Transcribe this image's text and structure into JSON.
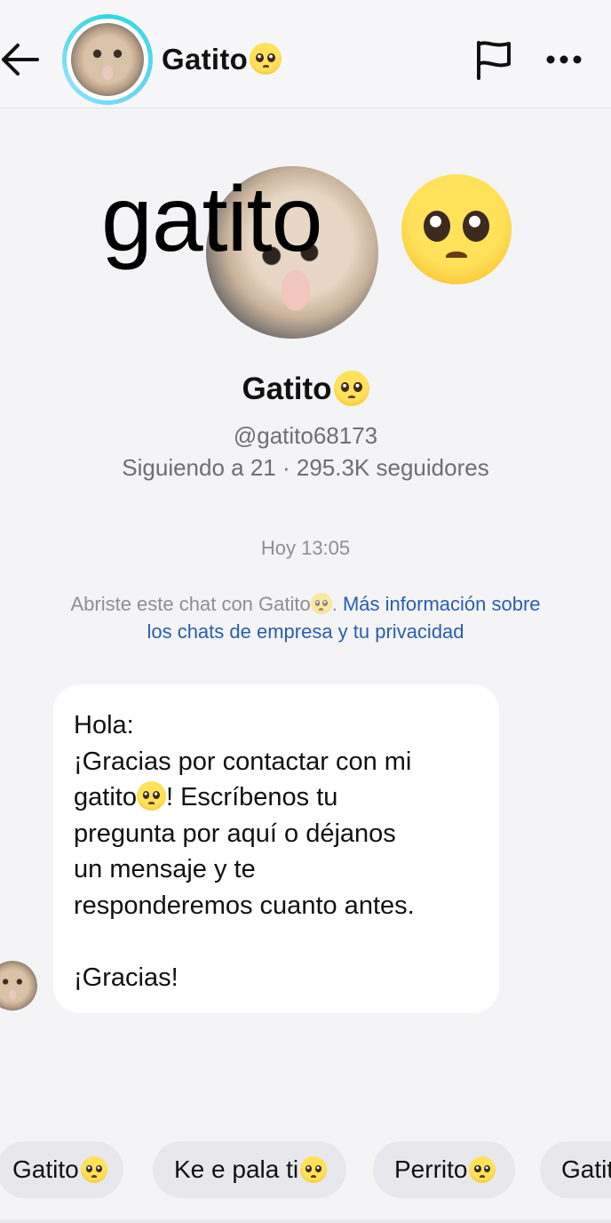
{
  "header": {
    "title": "Gatito",
    "back_icon": "back-arrow-icon",
    "flag_icon": "flag-icon",
    "more_icon": "more-options-icon"
  },
  "profile": {
    "overlay_text": "gatito",
    "name": "Gatito",
    "handle": "@gatito68173",
    "stats": "Siguiendo a 21 · 295.3K seguidores"
  },
  "chat": {
    "timestamp": "Hoy 13:05",
    "notice_prefix": "Abriste este chat con Gatito",
    "notice_suffix": ".",
    "notice_link": "Más información sobre los chats de empresa y tu privacidad",
    "message_part1": "Hola:\n¡Gracias por contactar con mi gatito",
    "message_part2": "! Escríbenos tu\npregunta por aquí o déjanos\nun mensaje y te\nresponderemos cuanto antes.\n\n¡Gracias!"
  },
  "quick_replies": [
    {
      "label": "Gatito"
    },
    {
      "label": "Ke e pala ti"
    },
    {
      "label": "Perrito"
    },
    {
      "label": "Gatito"
    }
  ],
  "colors": {
    "accent_link": "#2a5db0",
    "ring": "#2ed8e0",
    "background": "#f4f4f6"
  }
}
